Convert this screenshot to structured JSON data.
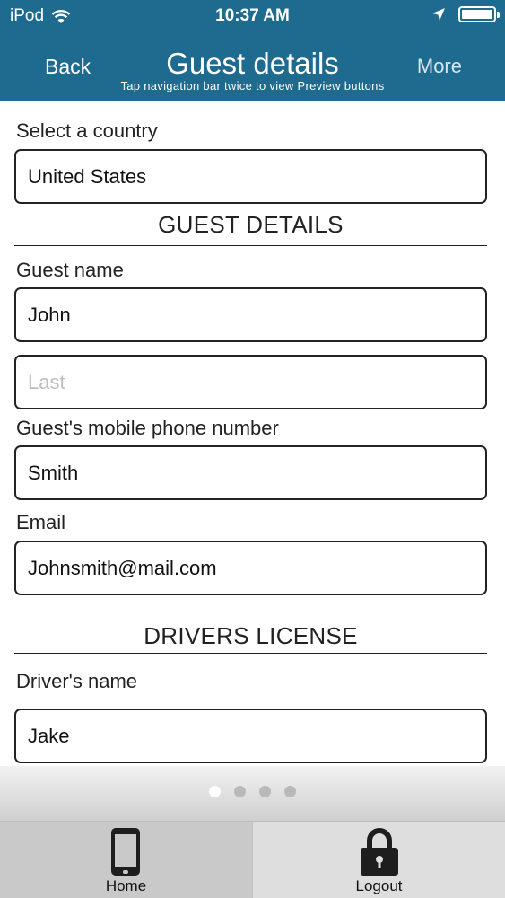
{
  "status_bar": {
    "carrier": "iPod",
    "time": "10:37 AM"
  },
  "nav": {
    "back_label": "Back",
    "title": "Guest details",
    "hint": "Tap navigation bar twice to view Preview buttons",
    "more_label": "More"
  },
  "form": {
    "country_label": "Select a country",
    "country_value": "United States",
    "guest_section": "GUEST DETAILS",
    "guest_name_label": "Guest name",
    "first_name_value": "John",
    "last_name_placeholder": "Last",
    "phone_label": "Guest's mobile phone number",
    "phone_value": "Smith",
    "email_label": "Email",
    "email_value": "Johnsmith@mail.com",
    "license_section": "DRIVERS LICENSE",
    "driver_name_label": "Driver's name",
    "driver_name_value": "Jake"
  },
  "pager": {
    "pages": 4,
    "current": 1
  },
  "tabbar": {
    "home_label": "Home",
    "logout_label": "Logout"
  },
  "colors": {
    "nav_bar": "#1f6a8f",
    "tab_home_bg": "#c9c9c9",
    "tab_logout_bg": "#dedede"
  },
  "icons": [
    "wifi-icon",
    "location-arrow-icon",
    "battery-icon",
    "phone-icon",
    "lock-icon"
  ]
}
